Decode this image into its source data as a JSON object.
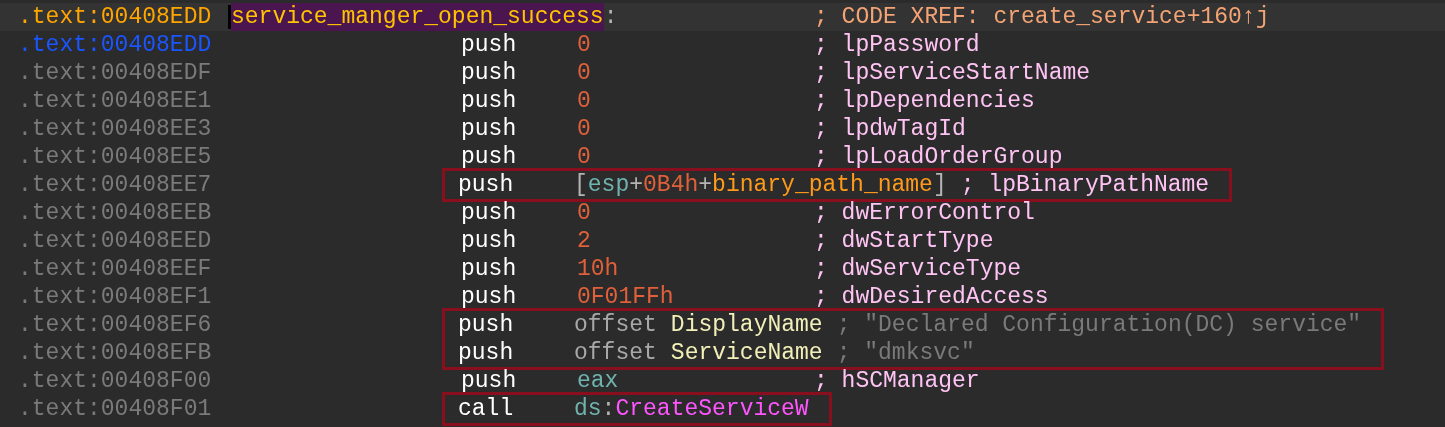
{
  "listing": {
    "rows": [
      {
        "kind": "label",
        "address": "00408EDD",
        "segment": ".text:",
        "selected": false,
        "current": true,
        "label": "service_manger_open_success",
        "label_suffix": ":",
        "comment": {
          "kind": "xref",
          "text": "; CODE XREF: create_service+160↑j"
        },
        "boxed": false
      },
      {
        "kind": "instruction",
        "address": "00408EDD",
        "segment": ".text:",
        "selected": true,
        "current": false,
        "mnemonic": "push",
        "operand": [
          {
            "kind": "number",
            "text": "0"
          }
        ],
        "comment": {
          "kind": "arg",
          "text": "; lpPassword"
        },
        "boxed": false
      },
      {
        "kind": "instruction",
        "address": "00408EDF",
        "segment": ".text:",
        "selected": false,
        "current": false,
        "mnemonic": "push",
        "operand": [
          {
            "kind": "number",
            "text": "0"
          }
        ],
        "comment": {
          "kind": "arg",
          "text": "; lpServiceStartName"
        },
        "boxed": false
      },
      {
        "kind": "instruction",
        "address": "00408EE1",
        "segment": ".text:",
        "selected": false,
        "current": false,
        "mnemonic": "push",
        "operand": [
          {
            "kind": "number",
            "text": "0"
          }
        ],
        "comment": {
          "kind": "arg",
          "text": "; lpDependencies"
        },
        "boxed": false
      },
      {
        "kind": "instruction",
        "address": "00408EE3",
        "segment": ".text:",
        "selected": false,
        "current": false,
        "mnemonic": "push",
        "operand": [
          {
            "kind": "number",
            "text": "0"
          }
        ],
        "comment": {
          "kind": "arg",
          "text": "; lpdwTagId"
        },
        "boxed": false
      },
      {
        "kind": "instruction",
        "address": "00408EE5",
        "segment": ".text:",
        "selected": false,
        "current": false,
        "mnemonic": "push",
        "operand": [
          {
            "kind": "number",
            "text": "0"
          }
        ],
        "comment": {
          "kind": "arg",
          "text": "; lpLoadOrderGroup"
        },
        "boxed": false
      },
      {
        "kind": "instruction",
        "address": "00408EE7",
        "segment": ".text:",
        "selected": false,
        "current": false,
        "mnemonic": "push",
        "operand": [
          {
            "kind": "punct",
            "text": "["
          },
          {
            "kind": "register",
            "text": "esp"
          },
          {
            "kind": "punct",
            "text": "+"
          },
          {
            "kind": "number",
            "text": "0B4h"
          },
          {
            "kind": "punct",
            "text": "+"
          },
          {
            "kind": "symbol",
            "text": "binary_path_name"
          },
          {
            "kind": "punct",
            "text": "]"
          }
        ],
        "comment": {
          "kind": "arg",
          "text": "; lpBinaryPathName"
        },
        "boxed": true
      },
      {
        "kind": "instruction",
        "address": "00408EEB",
        "segment": ".text:",
        "selected": false,
        "current": false,
        "mnemonic": "push",
        "operand": [
          {
            "kind": "number",
            "text": "0"
          }
        ],
        "comment": {
          "kind": "arg",
          "text": "; dwErrorControl"
        },
        "boxed": false
      },
      {
        "kind": "instruction",
        "address": "00408EED",
        "segment": ".text:",
        "selected": false,
        "current": false,
        "mnemonic": "push",
        "operand": [
          {
            "kind": "number",
            "text": "2"
          }
        ],
        "comment": {
          "kind": "arg",
          "text": "; dwStartType"
        },
        "boxed": false
      },
      {
        "kind": "instruction",
        "address": "00408EEF",
        "segment": ".text:",
        "selected": false,
        "current": false,
        "mnemonic": "push",
        "operand": [
          {
            "kind": "number",
            "text": "10h"
          }
        ],
        "comment": {
          "kind": "arg",
          "text": "; dwServiceType"
        },
        "boxed": false
      },
      {
        "kind": "instruction",
        "address": "00408EF1",
        "segment": ".text:",
        "selected": false,
        "current": false,
        "mnemonic": "push",
        "operand": [
          {
            "kind": "number",
            "text": "0F01FFh"
          }
        ],
        "comment": {
          "kind": "arg",
          "text": "; dwDesiredAccess"
        },
        "boxed": false
      },
      {
        "kind": "instruction",
        "address": "00408EF6",
        "segment": ".text:",
        "selected": false,
        "current": false,
        "mnemonic": "push",
        "operand": [
          {
            "kind": "keyword",
            "text": "offset"
          },
          {
            "kind": "name",
            "text": "DisplayName"
          }
        ],
        "comment": {
          "kind": "string",
          "text": "; \"Declared Configuration(DC) service\""
        },
        "boxed": true
      },
      {
        "kind": "instruction",
        "address": "00408EFB",
        "segment": ".text:",
        "selected": false,
        "current": false,
        "mnemonic": "push",
        "operand": [
          {
            "kind": "keyword",
            "text": "offset"
          },
          {
            "kind": "name",
            "text": "ServiceName"
          }
        ],
        "comment": {
          "kind": "string",
          "text": "; \"dmksvc\""
        },
        "boxed": true
      },
      {
        "kind": "instruction",
        "address": "00408F00",
        "segment": ".text:",
        "selected": false,
        "current": false,
        "mnemonic": "push",
        "operand": [
          {
            "kind": "register",
            "text": "eax"
          }
        ],
        "comment": {
          "kind": "arg",
          "text": "; hSCManager"
        },
        "boxed": false
      },
      {
        "kind": "instruction",
        "address": "00408F01",
        "segment": ".text:",
        "selected": false,
        "current": false,
        "mnemonic": "call",
        "operand": [
          {
            "kind": "register",
            "text": "ds"
          },
          {
            "kind": "punct",
            "text": ":"
          },
          {
            "kind": "import",
            "text": "CreateServiceW"
          }
        ],
        "boxed": true
      }
    ]
  }
}
